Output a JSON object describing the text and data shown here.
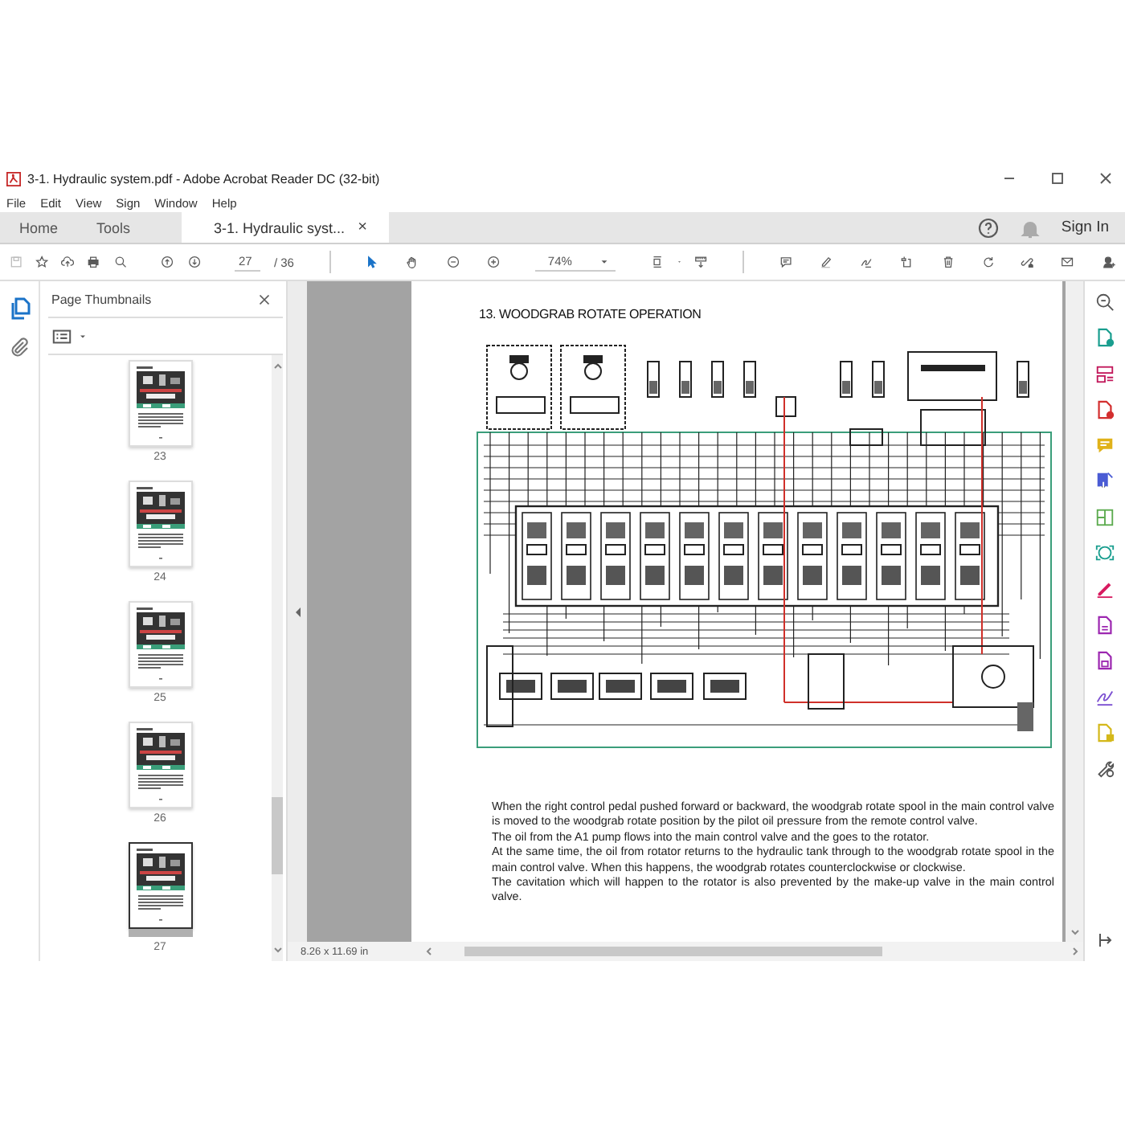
{
  "window": {
    "title": "3-1. Hydraulic system.pdf - Adobe Acrobat Reader DC (32-bit)"
  },
  "menu": [
    "File",
    "Edit",
    "View",
    "Sign",
    "Window",
    "Help"
  ],
  "tabs": [
    {
      "label": "Home",
      "selected": false
    },
    {
      "label": "Tools",
      "selected": false
    },
    {
      "label": "3-1. Hydraulic syst...",
      "selected": true,
      "close": "×"
    }
  ],
  "account": {
    "sign_in": "Sign In"
  },
  "toolbar": {
    "page_current": "27",
    "page_total": "/ 36",
    "zoom": "74%",
    "select_tool_selected": true
  },
  "thumbnails": {
    "title": "Page Thumbnails",
    "pages": [
      {
        "label": "23",
        "selected": false
      },
      {
        "label": "24",
        "selected": false
      },
      {
        "label": "25",
        "selected": false
      },
      {
        "label": "26",
        "selected": false
      },
      {
        "label": "27",
        "selected": true
      }
    ]
  },
  "document": {
    "heading": "13. WOODGRAB ROTATE OPERATION",
    "paragraphs": [
      "When the right control pedal pushed forward or backward, the woodgrab rotate spool in the main control valve is moved to the woodgrab rotate position by the pilot oil pressure from the remote control valve.",
      "The oil from the A1 pump flows into the main control valve and the goes to the rotator.",
      "At the same time, the oil from rotator returns to the hydraulic tank through to the woodgrab rotate spool in the main control valve. When this happens, the woodgrab rotates counterclockwise or clockwise.",
      "The cavitation which will happen to the rotator is also prevented by the make-up valve in the main control valve."
    ]
  },
  "status": {
    "page_size": "8.26 x 11.69 in"
  }
}
